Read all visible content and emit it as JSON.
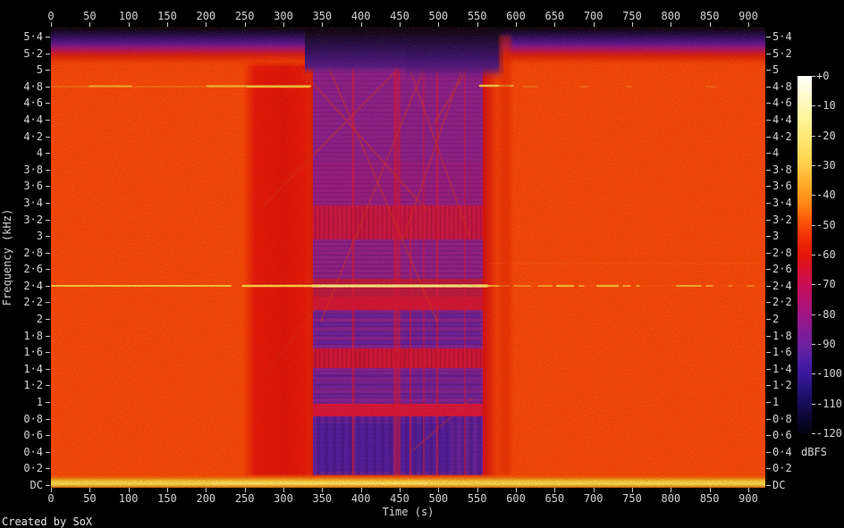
{
  "credit": "Created by SoX",
  "chart_data": {
    "type": "heatmap",
    "subtype": "audio-spectrogram",
    "title": "",
    "xlabel": "Time (s)",
    "ylabel": "Frequency (kHz)",
    "x_ticks": [
      0,
      50,
      100,
      150,
      200,
      250,
      300,
      350,
      400,
      450,
      500,
      550,
      600,
      650,
      700,
      750,
      800,
      850,
      900
    ],
    "x_range_s": [
      0,
      922
    ],
    "y_tick_labels": [
      "DC",
      "0·2",
      "0·4",
      "0·6",
      "0·8",
      "1",
      "1·2",
      "1·4",
      "1·6",
      "1·8",
      "2",
      "2·2",
      "2·4",
      "2·6",
      "2·8",
      "3",
      "3·2",
      "3·4",
      "3·6",
      "3·8",
      "4",
      "4·2",
      "4·4",
      "4·6",
      "4·8",
      "5",
      "5·2",
      "5·4"
    ],
    "y_range_khz": [
      0,
      5.51
    ],
    "colorbar": {
      "label": "dBFS",
      "tick_labels": [
        "+0",
        "-10",
        "-20",
        "-30",
        "-40",
        "-50",
        "-60",
        "-70",
        "-80",
        "-90",
        "-100",
        "-110",
        "-120"
      ],
      "range_dbfs": [
        0,
        -120
      ]
    },
    "legend_position": "right",
    "grid": false,
    "features": [
      {
        "name": "broadband-noise-floor",
        "time_s": [
          0,
          922
        ],
        "freq_khz": [
          0,
          5.3
        ],
        "level_dbfs": -45,
        "appearance": "orange"
      },
      {
        "name": "continuous-tone",
        "freq_khz": 2.4,
        "time_s": [
          0,
          565
        ],
        "level_dbfs": -12,
        "appearance": "bright yellow line, brightest 340-560 s"
      },
      {
        "name": "intermittent-tone",
        "freq_khz": 2.4,
        "time_s": [
          565,
          922
        ],
        "level_dbfs": -25,
        "appearance": "dashed yellow segments"
      },
      {
        "name": "weak-tone",
        "freq_khz": 4.8,
        "time_s": [
          0,
          335
        ],
        "level_dbfs": -35,
        "appearance": "faint yellow-orange dashes, also bright burst 540-570 s"
      },
      {
        "name": "dc-low-frequency-line",
        "freq_khz": 0,
        "time_s": [
          0,
          922
        ],
        "level_dbfs": -12,
        "appearance": "bright yellow band at DC"
      },
      {
        "name": "quiet-section",
        "time_s": [
          335,
          555
        ],
        "freq_khz": [
          0.1,
          5.2
        ],
        "level_dbfs": [
          -70,
          -100
        ],
        "appearance": "purple/blue blocks with diagonal chirp traces, vertical segment boundaries and stepped horizontal banding"
      },
      {
        "name": "reduced-level-band",
        "time_s": [
          280,
          335
        ],
        "freq_khz": [
          0,
          5.2
        ],
        "level_dbfs": -55,
        "appearance": "darker red vertical column before quiet section"
      },
      {
        "name": "lowpass-rolloff",
        "freq_khz": [
          5.4,
          5.51
        ],
        "time_s": [
          0,
          922
        ],
        "level_dbfs": -115,
        "appearance": "dark blue/black band at top edge (near Nyquist)"
      }
    ]
  }
}
